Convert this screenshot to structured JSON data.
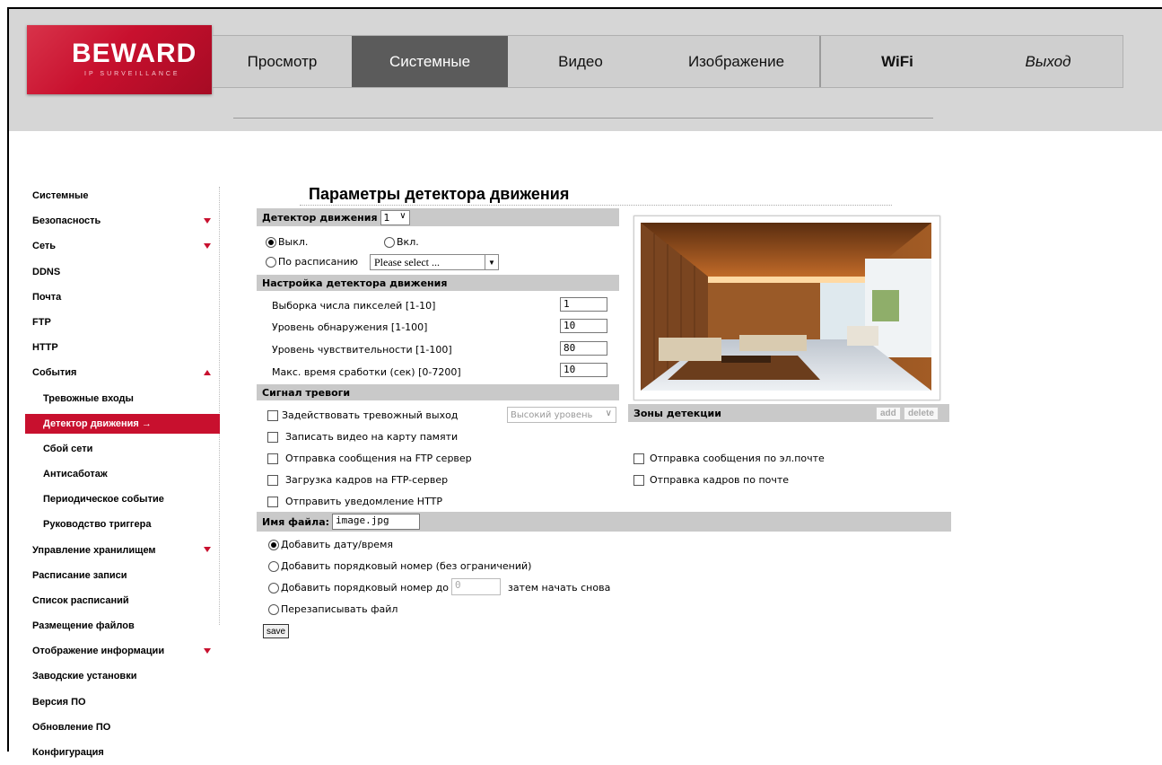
{
  "logo": {
    "brand": "BEWARD",
    "tagline": "IP SURVEILLANCE"
  },
  "nav": {
    "tabs": [
      "Просмотр",
      "Системные",
      "Видео",
      "Изображение",
      "WiFi",
      "Выход"
    ]
  },
  "sidebar": {
    "items": [
      "Системные",
      "Безопасность",
      "Сеть",
      "DDNS",
      "Почта",
      "FTP",
      "HTTP",
      "События",
      "Тревожные входы",
      "Детектор движения",
      "Сбой сети",
      "Антисаботаж",
      "Периодическое событие",
      "Руководство триггера",
      "Управление хранилищем",
      "Расписание записи",
      "Список расписаний",
      "Размещение файлов",
      "Отображение информации",
      "Заводские установки",
      "Версия ПО",
      "Обновление ПО",
      "Конфигурация"
    ],
    "active_arrow": "→"
  },
  "page": {
    "title": "Параметры детектора движения",
    "detector_label": "Детектор движения",
    "detector_value": "1",
    "off_label": "Выкл.",
    "on_label": "Вкл.",
    "schedule_label": "По расписанию",
    "schedule_select": "Please select ...",
    "settings_header": "Настройка детектора движения",
    "params": [
      {
        "label": "Выборка числа пикселей [1-10]",
        "value": "1"
      },
      {
        "label": "Уровень обнаружения [1-100]",
        "value": "10"
      },
      {
        "label": "Уровень чувствительности [1-100]",
        "value": "80"
      },
      {
        "label": "Макс. время сработки (сек) [0-7200]",
        "value": "10"
      }
    ],
    "alarm_header": "Сигнал тревоги",
    "alarm_output_label": "Задействовать тревожный выход",
    "alarm_level": "Высокий уровень",
    "record_sd": "Записать видео на карту памяти",
    "ftp_message": "Отправка сообщения на FTP сервер",
    "ftp_upload": "Загрузка кадров на FTP-сервер",
    "http_notify": "Отправить уведомление HTTP",
    "email_message": "Отправка сообщения по эл.почте",
    "email_frames": "Отправка кадров по почте",
    "zones_label": "Зоны детекции",
    "add_label": "add",
    "delete_label": "delete",
    "filename_label": "Имя файла:",
    "filename_value": "image.jpg",
    "opt_datetime": "Добавить дату/время",
    "opt_seq_unlimited": "Добавить порядковый номер (без ограничений)",
    "opt_seq_to": "Добавить порядковый номер до",
    "opt_seq_value": "0",
    "opt_seq_restart": "затем начать снова",
    "opt_overwrite": "Перезаписывать файл",
    "save_label": "save"
  }
}
